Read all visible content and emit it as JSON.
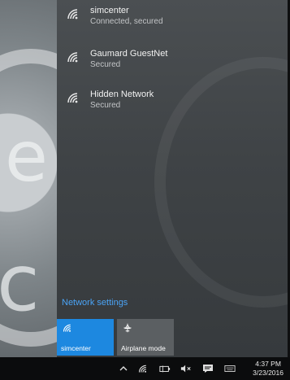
{
  "networks": [
    {
      "name": "simcenter",
      "status": "Connected, secured"
    },
    {
      "name": "Gaumard GuestNet",
      "status": "Secured"
    },
    {
      "name": "Hidden Network",
      "status": "Secured"
    }
  ],
  "network_settings_label": "Network settings",
  "quick_actions": [
    {
      "label": "simcenter",
      "icon": "wifi-icon",
      "state": "on"
    },
    {
      "label": "Airplane mode",
      "icon": "airplane-icon",
      "state": "off"
    }
  ],
  "taskbar": {
    "time": "4:37 PM",
    "date": "3/23/2016",
    "icons": [
      "chevron-up-icon",
      "wifi-icon",
      "battery-icon",
      "volume-muted-icon",
      "action-center-icon",
      "keyboard-icon"
    ]
  },
  "colors": {
    "flyout_bg": "#3f4346",
    "accent": "#1d88e0",
    "link": "#4aa3f5",
    "taskbar_bg": "#0b0c0d"
  }
}
